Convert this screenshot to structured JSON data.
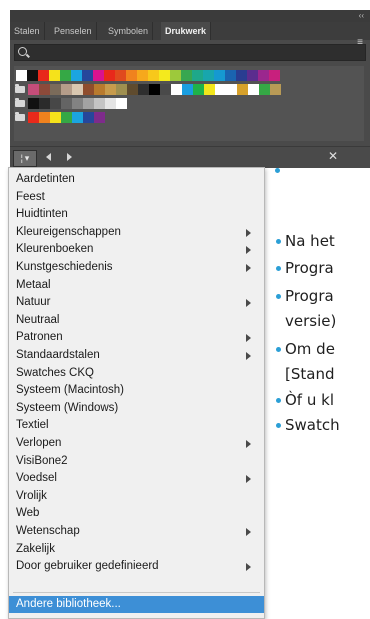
{
  "panel": {
    "tabs": [
      {
        "label": "Stalen",
        "active": false
      },
      {
        "label": "Penselen",
        "active": false
      },
      {
        "label": "Symbolen",
        "active": false
      },
      {
        "label": "Drukwerk",
        "active": true
      }
    ],
    "search_placeholder": "",
    "swatch_rows": [
      {
        "folder": false,
        "colors": [
          "#ffffff",
          "#111111",
          "#e8291b",
          "#f5e21b",
          "#35a845",
          "#1ba5e0",
          "#26479b",
          "#d9138f",
          "#e8291b",
          "#e04a1e",
          "#f0821e",
          "#f6a81c",
          "#f7c81b",
          "#f4ea1d",
          "#9dc93b",
          "#38a750",
          "#1ea88a",
          "#18a6ad",
          "#1599d1",
          "#1a64b0",
          "#293d91",
          "#5b2d8e",
          "#9b278e",
          "#c8207d"
        ]
      },
      {
        "folder": true,
        "colors": [
          "#c54d79",
          "#8c4a3a",
          "#7b6b5a",
          "#b59d8a",
          "#d9c7b0",
          "#8f4d2d",
          "#b87a2e",
          "#c79b4c",
          "#9f8f4f",
          "#5f4b2e",
          "#2f2f2f",
          "#000000",
          "#4a4a4a",
          "#ffffff",
          "#1a9ee0",
          "#1fb24a",
          "#f2e61c",
          "#ffffff",
          "#ffffff",
          "#d7a12b",
          "#ffffff",
          "#35a845",
          "#b89a56"
        ]
      },
      {
        "folder": true,
        "colors": [
          "#111111",
          "#2b2b2b",
          "#474747",
          "#646464",
          "#828282",
          "#a3a3a3",
          "#c4c4c4",
          "#e4e4e4",
          "#ffffff"
        ]
      },
      {
        "folder": true,
        "colors": [
          "#e8291b",
          "#f0821e",
          "#f5e21b",
          "#35a845",
          "#1ba5e0",
          "#26479b",
          "#7e2b8b"
        ]
      }
    ],
    "library_button_label": "¦ ▾",
    "close_icon": "✕"
  },
  "menu": {
    "items": [
      {
        "label": "Aardetinten",
        "submenu": false
      },
      {
        "label": "Feest",
        "submenu": false
      },
      {
        "label": "Huidtinten",
        "submenu": false
      },
      {
        "label": "Kleureigenschappen",
        "submenu": true
      },
      {
        "label": "Kleurenboeken",
        "submenu": true
      },
      {
        "label": "Kunstgeschiedenis",
        "submenu": true
      },
      {
        "label": "Metaal",
        "submenu": false
      },
      {
        "label": "Natuur",
        "submenu": true
      },
      {
        "label": "Neutraal",
        "submenu": false
      },
      {
        "label": "Patronen",
        "submenu": true
      },
      {
        "label": "Standaardstalen",
        "submenu": true
      },
      {
        "label": "Swatches CKQ",
        "submenu": false
      },
      {
        "label": "Systeem (Macintosh)",
        "submenu": false
      },
      {
        "label": "Systeem (Windows)",
        "submenu": false
      },
      {
        "label": "Textiel",
        "submenu": false
      },
      {
        "label": "Verlopen",
        "submenu": true
      },
      {
        "label": "VisiBone2",
        "submenu": false
      },
      {
        "label": "Voedsel",
        "submenu": true
      },
      {
        "label": "Vrolijk",
        "submenu": false
      },
      {
        "label": "Web",
        "submenu": false
      },
      {
        "label": "Wetenschap",
        "submenu": true
      },
      {
        "label": "Zakelijk",
        "submenu": false
      },
      {
        "label": "Door gebruiker gedefinieerd",
        "submenu": true
      },
      {
        "label": "Andere bibliotheek...",
        "submenu": false,
        "selected": true
      }
    ]
  },
  "background_text": [
    "Na het",
    "Progra",
    "Progra",
    "versie)",
    "Om de",
    "[Stand",
    "Òf u kl",
    "Swatch"
  ],
  "colors": {
    "accent": "#3d8fd6",
    "bullet": "#2b9fd6",
    "panel_bg": "#4a4a4a"
  }
}
